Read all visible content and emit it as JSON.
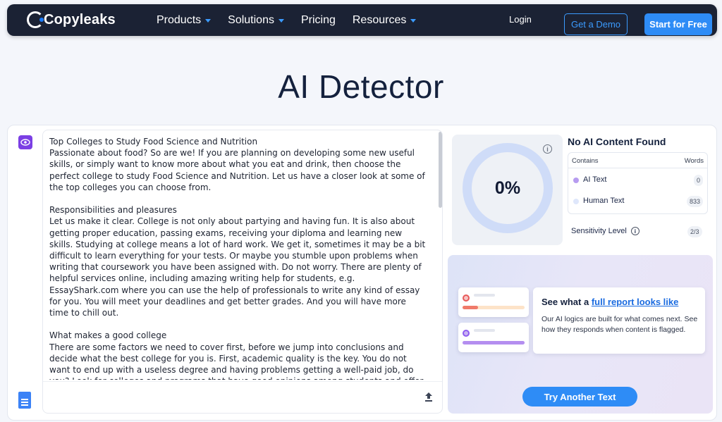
{
  "nav": {
    "logo_text": "Copyleaks",
    "links": [
      {
        "label": "Products",
        "dropdown": true
      },
      {
        "label": "Solutions",
        "dropdown": true
      },
      {
        "label": "Pricing",
        "dropdown": false
      },
      {
        "label": "Resources",
        "dropdown": true
      }
    ],
    "login": "Login",
    "demo": "Get a Demo",
    "start": "Start for Free"
  },
  "page_title": "AI Detector",
  "editor": {
    "paragraphs": [
      [
        "Top Colleges to Study Food Science and Nutrition",
        "Passionate about food? So are we! If you are planning on developing some new useful skills, or simply want to know more about what you eat and drink, then choose the perfect college to study Food Science and Nutrition. Let us have a closer look at some of the top colleges you can choose from."
      ],
      [
        "Responsibilities and pleasures",
        "Let us make it clear. College is not only about partying and having fun. It is also about getting proper education, passing exams, receiving your diploma and learning new skills. Studying at college means a lot of hard work. We get it, sometimes it may be a bit difficult to learn everything for your tests. Or maybe you stumble upon problems when writing that coursework you have been assigned with. Do not worry. There are plenty of helpful services online, including amazing writing help for students, e.g. EssayShark.com where you can use the help of professionals to write any kind of essay for you. You will meet your deadlines and get better grades. And you will have more time to chill out."
      ],
      [
        "What makes a good college",
        "There are some factors we need to cover first, before we jump into conclusions and decide what the best college for you is. First, academic quality is the key. You do not want to end up with a useless degree and having problems getting a well-paid job, do you? Look for colleges and programs that have good opinions among students and offer good-quality education in general. The other thing is geographic location. Are you looking for a college in your hometown? Or"
      ]
    ]
  },
  "result": {
    "percent": "0%",
    "verdict": "No AI Content Found",
    "table_header_left": "Contains",
    "table_header_right": "Words",
    "rows": [
      {
        "label": "AI Text",
        "count": "0",
        "color": "#b79cf0"
      },
      {
        "label": "Human Text",
        "count": "833",
        "color": "#dfe7fb"
      }
    ],
    "sensitivity_label": "Sensitivity Level",
    "sensitivity_value": "2/3"
  },
  "promo": {
    "heading_prefix": "See what a ",
    "heading_link": "full report looks like",
    "body": "Our AI logics are built for what comes next. See how they responds when content is flagged.",
    "button": "Try Another Text"
  },
  "colors": {
    "accent": "#2e8cf6",
    "nav_bg": "#1b2234",
    "ring": "#cfdcf8",
    "purple": "#7b3fe4"
  }
}
